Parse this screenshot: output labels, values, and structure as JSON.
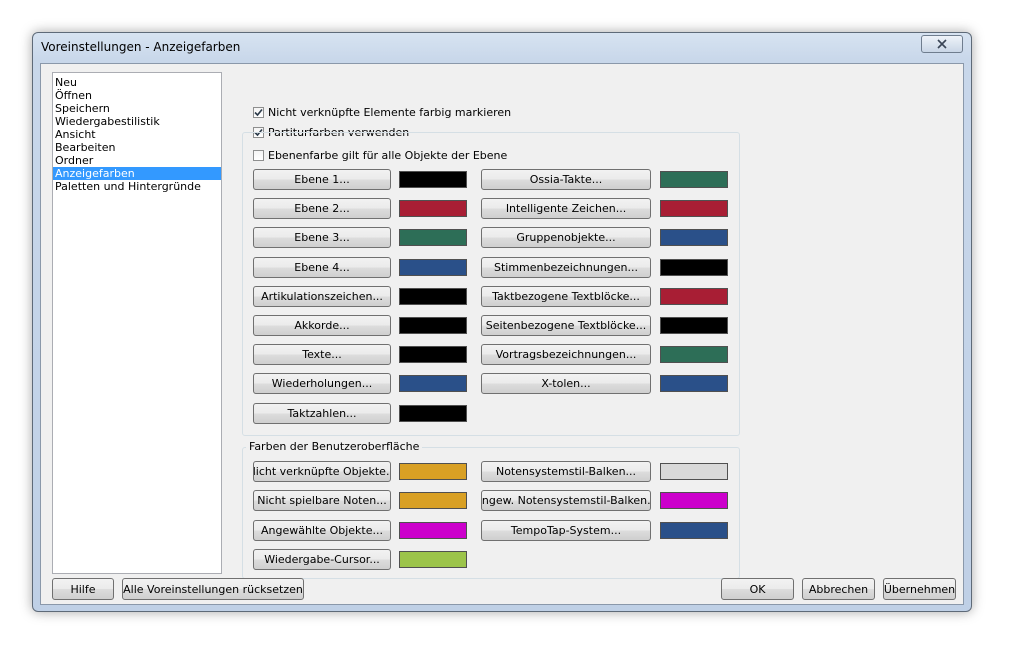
{
  "window": {
    "title": "Voreinstellungen - Anzeigefarben"
  },
  "icons": {
    "close": "close-icon",
    "checkmark": "checkmark-icon"
  },
  "categories": [
    {
      "label": "Neu",
      "selected": false
    },
    {
      "label": "Öffnen",
      "selected": false
    },
    {
      "label": "Speichern",
      "selected": false
    },
    {
      "label": "Wiedergabestilistik",
      "selected": false
    },
    {
      "label": "Ansicht",
      "selected": false
    },
    {
      "label": "Bearbeiten",
      "selected": false
    },
    {
      "label": "Ordner",
      "selected": false
    },
    {
      "label": "Anzeigefarben",
      "selected": true
    },
    {
      "label": "Paletten und Hintergründe",
      "selected": false
    }
  ],
  "options": {
    "unlinked": {
      "label": "Nicht verknüpfte Elemente farbig markieren",
      "checked": true
    },
    "score_colors": {
      "label": "Partiturfarben verwenden",
      "checked": true
    },
    "layer_color": {
      "label": "Ebenenfarbe gilt für alle Objekte der Ebene",
      "checked": false
    }
  },
  "score_left": [
    {
      "label": "Ebene 1...",
      "color": "#000000"
    },
    {
      "label": "Ebene 2...",
      "color": "#a81e34"
    },
    {
      "label": "Ebene 3...",
      "color": "#2d6e57"
    },
    {
      "label": "Ebene 4...",
      "color": "#2a5089"
    },
    {
      "label": "Artikulationszeichen...",
      "color": "#000000"
    },
    {
      "label": "Akkorde...",
      "color": "#000000"
    },
    {
      "label": "Texte...",
      "color": "#000000"
    },
    {
      "label": "Wiederholungen...",
      "color": "#2a5089"
    },
    {
      "label": "Taktzahlen...",
      "color": "#000000"
    }
  ],
  "score_right": [
    {
      "label": "Ossia-Takte...",
      "color": "#2d6e57"
    },
    {
      "label": "Intelligente Zeichen...",
      "color": "#a81e34"
    },
    {
      "label": "Gruppenobjekte...",
      "color": "#2a5089"
    },
    {
      "label": "Stimmenbezeichnungen...",
      "color": "#000000"
    },
    {
      "label": "Taktbezogene Textblöcke...",
      "color": "#a81e34"
    },
    {
      "label": "Seitenbezogene Textblöcke...",
      "color": "#000000"
    },
    {
      "label": "Vortragsbezeichnungen...",
      "color": "#2d6e57"
    },
    {
      "label": "X-tolen...",
      "color": "#2a5089"
    }
  ],
  "ui_colors": {
    "title": "Farben der Benutzeroberfläche",
    "left": [
      {
        "label": "Nicht verknüpfte Objekte...",
        "color": "#d9a024"
      },
      {
        "label": "Nicht spielbare Noten...",
        "color": "#d9a024"
      },
      {
        "label": "Angewählte Objekte...",
        "color": "#cc00cc"
      },
      {
        "label": "Wiedergabe-Cursor...",
        "color": "#9cc44a"
      }
    ],
    "right": [
      {
        "label": "Notensystemstil-Balken...",
        "color": "#d9d9d9"
      },
      {
        "label": "Angew. Notensystemstil-Balken...",
        "color": "#cc00cc"
      },
      {
        "label": "TempoTap-System...",
        "color": "#2a5089"
      }
    ]
  },
  "footer": {
    "help": "Hilfe",
    "reset_all": "Alle Voreinstellungen rücksetzen",
    "ok": "OK",
    "cancel": "Abbrechen",
    "apply": "Übernehmen"
  }
}
